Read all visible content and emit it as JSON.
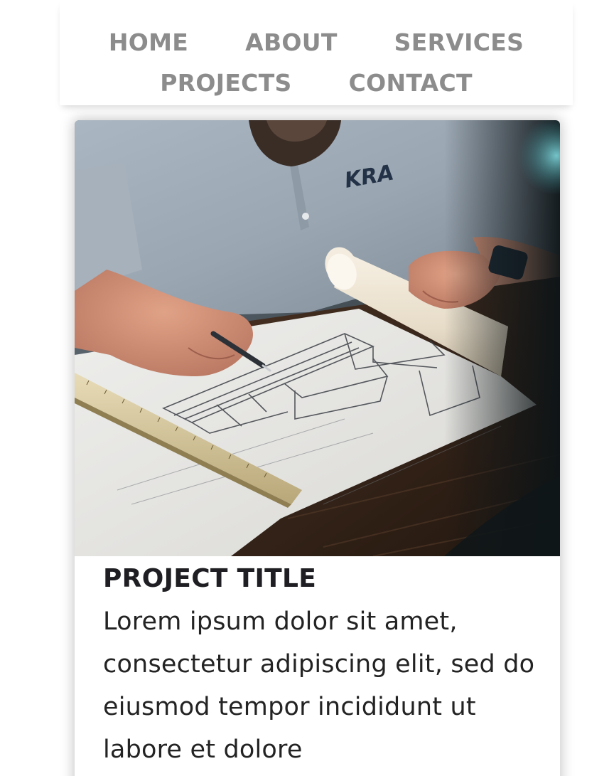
{
  "nav": {
    "items": [
      {
        "label": "HOME"
      },
      {
        "label": "ABOUT"
      },
      {
        "label": "SERVICES"
      },
      {
        "label": "PROJECTS"
      },
      {
        "label": "CONTACT"
      }
    ]
  },
  "project_card": {
    "title": "PROJECT TITLE",
    "description": "Lorem ipsum dolor sit amet, consectetur adipiscing elit, sed do eiusmod tempor incididunt ut labore et dolore",
    "image": {
      "shirt_logo_text": "KRA"
    }
  },
  "colors": {
    "nav_text": "#8c8c8c",
    "title_text": "#1f1f23",
    "body_text": "#232323"
  }
}
